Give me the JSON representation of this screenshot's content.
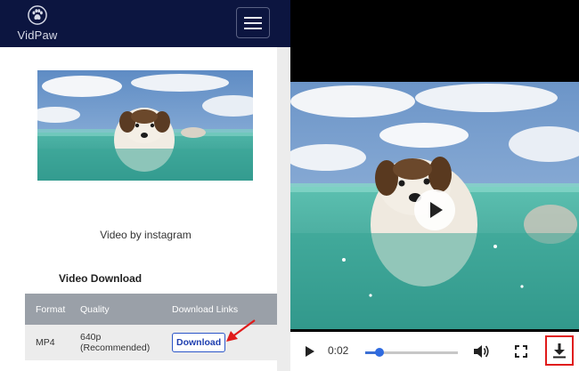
{
  "app": {
    "logo_text": "VidPaw"
  },
  "page": {
    "caption": "Video by instagram",
    "section_title": "Video Download"
  },
  "table": {
    "headers": [
      "Format",
      "Quality",
      "Download Links"
    ],
    "rows": [
      {
        "format": "MP4",
        "quality_line1": "640p",
        "quality_line2": "(Recommended)",
        "action": "Download"
      }
    ]
  },
  "player": {
    "time": "0:02",
    "progress_fraction": 0.15
  },
  "colors": {
    "header_bg": "#0c1540",
    "table_header_bg": "#9aa0a8",
    "download_button": "#1f3fb0",
    "highlight_red": "#e01b1b",
    "progress_blue": "#2f6be0"
  },
  "icons": [
    "paw-logo-icon",
    "hamburger-menu-icon",
    "play-icon",
    "volume-icon",
    "fullscreen-icon",
    "download-icon",
    "red-arrow-icon"
  ]
}
